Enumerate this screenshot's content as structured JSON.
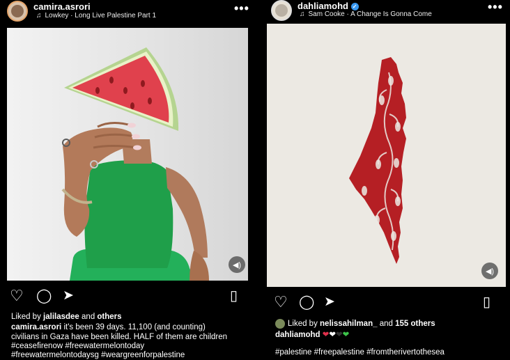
{
  "left": {
    "username": "camira.asrori",
    "song": "Lowkey · Long Live Palestine Part 1",
    "more": "•••",
    "likes": {
      "prefix": "Liked by ",
      "user": "jalilasdee",
      "mid": " and ",
      "suffix": "others"
    },
    "caption": {
      "user": "camira.asrori",
      "line1": " it's been 39 days. 11,100 (and counting)",
      "line2": "civilians in Gaza have been killed. HALF of them are children",
      "line3": "#ceasefirenow #freewatermelontoday",
      "line4": "#freewatermelontodaysg #weargreenforpalestine"
    }
  },
  "right": {
    "username": "dahliamohd",
    "song": "Sam Cooke · A Change Is Gonna Come",
    "more": "•••",
    "likes": {
      "prefix": "Liked by ",
      "user": "nelissahilman_",
      "mid": " and ",
      "suffix": "155 others"
    },
    "caption_user": "dahliamohd",
    "hashtags": "#palestine #freepalestine #fromtherivertothesea"
  },
  "icons": {
    "music": "music-note-icon",
    "heart": "heart-icon",
    "comment": "comment-icon",
    "share": "send-icon",
    "save": "bookmark-icon",
    "sound": "volume-icon",
    "verified": "verified-badge-icon"
  },
  "colors": {
    "background": "#000000",
    "watermelon": "#e0414d",
    "tank_top": "#1f9f4a",
    "map": "#b51f24"
  }
}
